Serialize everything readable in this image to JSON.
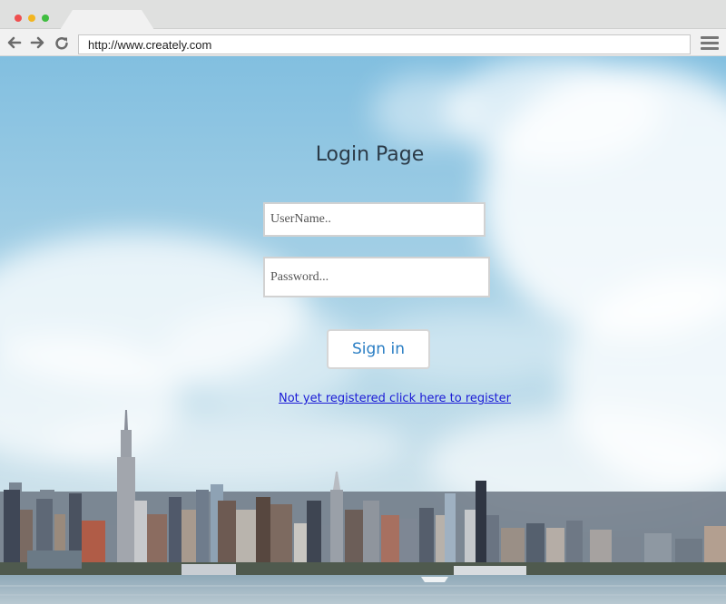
{
  "browser": {
    "url": "http://www.creately.com"
  },
  "page": {
    "title": "Login Page",
    "username_placeholder": "UserName..",
    "password_placeholder": "Password...",
    "signin_label": "Sign in",
    "register_link_text": "Not yet registered click here to register"
  },
  "colors": {
    "accent": "#2a7ec4",
    "link": "#1a1ad6",
    "sky": "#9cc9e0"
  }
}
